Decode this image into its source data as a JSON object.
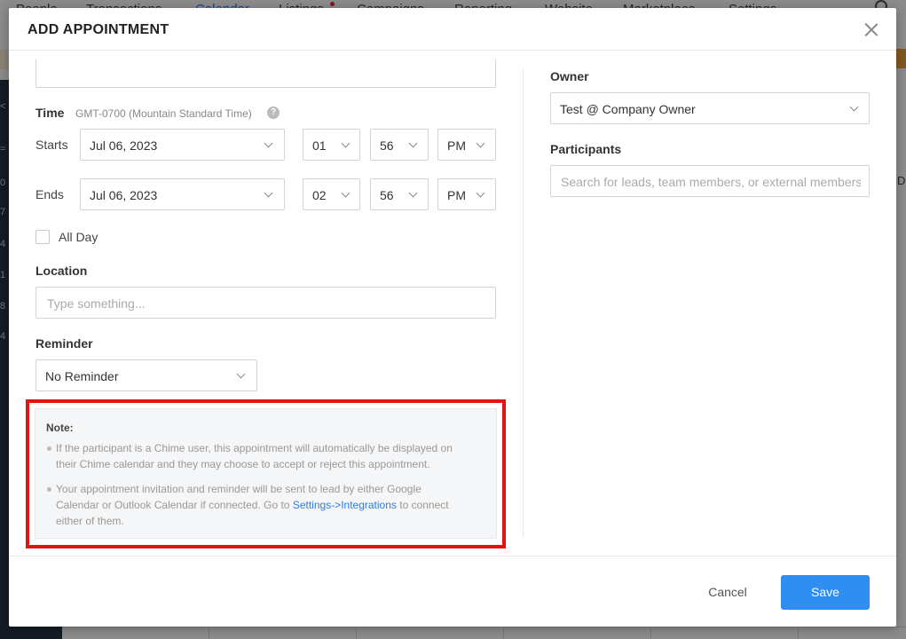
{
  "background": {
    "nav_items": [
      "People",
      "Transactions",
      "Calendar",
      "Listings",
      "Campaigns",
      "Reporting",
      "Website",
      "Marketplace",
      "Settings"
    ],
    "sidebar_digits": [
      "<",
      "=",
      "0",
      "7",
      "4",
      "1",
      "8",
      "4"
    ],
    "right_edge_text": "D"
  },
  "modal": {
    "title": "ADD APPOINTMENT",
    "time": {
      "label": "Time",
      "timezone": "GMT-0700 (Mountain Standard Time)",
      "help_icon": "?",
      "starts": {
        "label": "Starts",
        "date": "Jul 06, 2023",
        "hour": "01",
        "minute": "56",
        "ampm": "PM"
      },
      "ends": {
        "label": "Ends",
        "date": "Jul 06, 2023",
        "hour": "02",
        "minute": "56",
        "ampm": "PM"
      }
    },
    "all_day": {
      "label": "All Day",
      "checked": false
    },
    "location": {
      "label": "Location",
      "placeholder": "Type something..."
    },
    "reminder": {
      "label": "Reminder",
      "value": "No Reminder"
    },
    "note": {
      "title": "Note:",
      "bullet1": [
        "If the participant is a Chime user, this appointment will automatically be displayed on",
        "their Chime calendar and they may choose to accept or reject this appointment."
      ],
      "bullet2_line1": "Your appointment invitation and reminder will be sent to lead by either Google",
      "bullet2_line2_pre": "Calendar or Outlook Calendar if connected. Go to ",
      "bullet2_link": "Settings->Integrations",
      "bullet2_line2_post": " to connect",
      "bullet2_line3": "either of them."
    },
    "owner": {
      "label": "Owner",
      "value": "Test @ Company Owner"
    },
    "participants": {
      "label": "Participants",
      "placeholder": "Search for leads, team members, or external members"
    },
    "buttons": {
      "cancel": "Cancel",
      "save": "Save"
    }
  }
}
